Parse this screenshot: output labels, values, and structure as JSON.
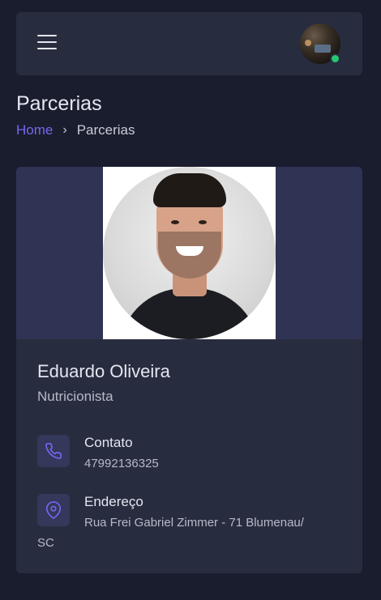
{
  "header": {
    "menu_icon": "hamburger-menu-icon",
    "avatar_status": "online",
    "status_color": "#28c76f"
  },
  "page": {
    "title": "Parcerias",
    "breadcrumb": {
      "home": "Home",
      "separator": "›",
      "current": "Parcerias"
    }
  },
  "profile": {
    "name": "Eduardo Oliveira",
    "role": "Nutricionista",
    "contact": {
      "icon": "phone-icon",
      "label": "Contato",
      "value": "47992136325"
    },
    "address": {
      "icon": "map-pin-icon",
      "label": "Endereço",
      "value_line1": "Rua Frei Gabriel Zimmer - 71 Blumenau/",
      "value_line2": "SC"
    }
  },
  "colors": {
    "background": "#1a1d2e",
    "card": "#282c3f",
    "accent": "#7367f0"
  }
}
